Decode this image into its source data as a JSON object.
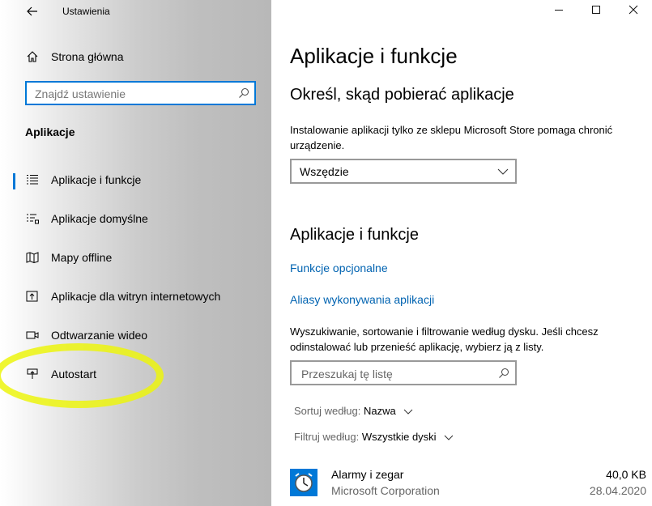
{
  "window": {
    "title": "Ustawienia",
    "back_icon": "back-arrow-icon",
    "minimize_icon": "minimize-icon",
    "maximize_icon": "maximize-icon",
    "close_icon": "close-icon"
  },
  "sidebar": {
    "home_label": "Strona główna",
    "search_placeholder": "Znajdź ustawienie",
    "section_title": "Aplikacje",
    "items": [
      {
        "label": "Aplikacje i funkcje",
        "icon": "apps-features-icon",
        "active": true
      },
      {
        "label": "Aplikacje domyślne",
        "icon": "default-apps-icon",
        "active": false
      },
      {
        "label": "Mapy offline",
        "icon": "offline-maps-icon",
        "active": false
      },
      {
        "label": "Aplikacje dla witryn internetowych",
        "icon": "apps-for-websites-icon",
        "active": false
      },
      {
        "label": "Odtwarzanie wideo",
        "icon": "video-playback-icon",
        "active": false
      },
      {
        "label": "Autostart",
        "icon": "startup-icon",
        "active": false
      }
    ]
  },
  "main": {
    "page_title": "Aplikacje i funkcje",
    "source_heading": "Określ, skąd pobierać aplikacje",
    "source_description": "Instalowanie aplikacji tylko ze sklepu Microsoft Store pomaga chronić urządzenie.",
    "source_dropdown_value": "Wszędzie",
    "apps_heading": "Aplikacje i funkcje",
    "link_optional_features": "Funkcje opcjonalne",
    "link_execution_aliases": "Aliasy wykonywania aplikacji",
    "list_description": "Wyszukiwanie, sortowanie i filtrowanie według dysku. Jeśli chcesz odinstalować lub przenieść aplikację, wybierz ją z listy.",
    "list_search_placeholder": "Przeszukaj tę listę",
    "sort_label": "Sortuj według:",
    "sort_value": "Nazwa",
    "filter_label": "Filtruj według:",
    "filter_value": "Wszystkie dyski",
    "apps": [
      {
        "name": "Alarmy i zegar",
        "publisher": "Microsoft Corporation",
        "size": "40,0 KB",
        "date": "28.04.2020",
        "icon": "alarm-clock-icon"
      }
    ]
  },
  "colors": {
    "accent": "#0078d7",
    "link": "#0063b1",
    "annotation": "#ecf40e"
  }
}
